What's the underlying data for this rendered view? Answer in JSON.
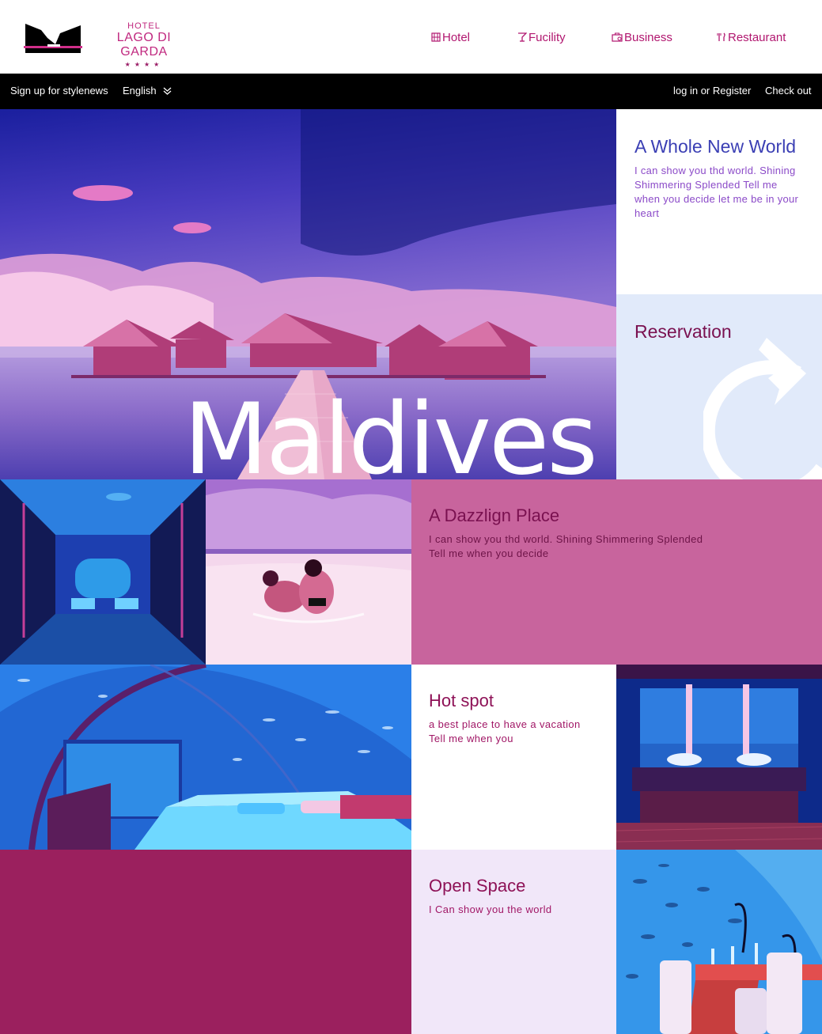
{
  "brand": {
    "line1": "HOTEL",
    "line2": "LAGO DI GARDA",
    "stars": "★★★★"
  },
  "nav": {
    "hotel": "Hotel",
    "facility": "Fucility",
    "business": "Business",
    "restaurant": "Restaurant"
  },
  "topbar": {
    "signup": "Sign up for stylenews",
    "language": "English",
    "login": "log in or Register",
    "checkout": "Check out"
  },
  "hero": {
    "title": "Maldives"
  },
  "intro": {
    "title": "A Whole New World",
    "text": "I can show you thd world. Shining Shimmering Splended Tell me when you decide let me be in your heart"
  },
  "reservation": {
    "title": "Reservation",
    "icon": "redo-arrow-icon"
  },
  "dazzle": {
    "title": "A Dazzlign Place",
    "line1": "I can show you thd world. Shining Shimmering Splended",
    "line2": "Tell me when you decide"
  },
  "hotspot": {
    "title": "Hot spot",
    "line1": "a best place to have a vacation",
    "line2": "Tell me when you"
  },
  "openspace": {
    "title": "Open Space",
    "text": "I Can show you the world"
  },
  "colors": {
    "accent": "#b1166f",
    "intro_title": "#3b3fb4",
    "dazzle_bg": "#c8649d",
    "solid_bg": "#9b205e",
    "reservation_bg": "#e1eafa",
    "openspace_bg": "#f1e7f9"
  }
}
